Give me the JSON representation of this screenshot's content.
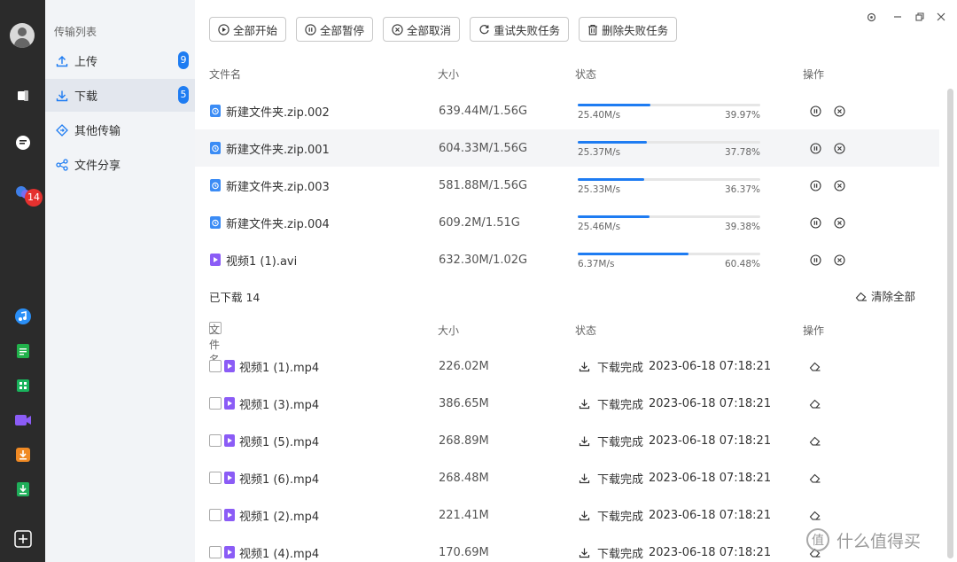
{
  "rail": {
    "notification_count": "14"
  },
  "nav": {
    "title": "传输列表",
    "items": [
      {
        "label": "上传",
        "count": "9",
        "icon": "upload-icon"
      },
      {
        "label": "下载",
        "count": "5",
        "icon": "download-icon",
        "active": true
      },
      {
        "label": "其他传输",
        "icon": "transfer-icon"
      },
      {
        "label": "文件分享",
        "icon": "share-icon"
      }
    ]
  },
  "toolbar": {
    "start_all": "全部开始",
    "pause_all": "全部暂停",
    "cancel_all": "全部取消",
    "retry_failed": "重试失败任务",
    "delete_failed": "删除失败任务"
  },
  "columns": {
    "name": "文件名",
    "size": "大小",
    "status": "状态",
    "actions": "操作"
  },
  "active_downloads": [
    {
      "name": "新建文件夹.zip.002",
      "size": "639.44M/1.56G",
      "speed": "25.40M/s",
      "percent": "39.97%",
      "progress": 0.3997,
      "type": "zip"
    },
    {
      "name": "新建文件夹.zip.001",
      "size": "604.33M/1.56G",
      "speed": "25.37M/s",
      "percent": "37.78%",
      "progress": 0.3778,
      "type": "zip"
    },
    {
      "name": "新建文件夹.zip.003",
      "size": "581.88M/1.56G",
      "speed": "25.33M/s",
      "percent": "36.37%",
      "progress": 0.3637,
      "type": "zip"
    },
    {
      "name": "新建文件夹.zip.004",
      "size": "609.2M/1.51G",
      "speed": "25.46M/s",
      "percent": "39.38%",
      "progress": 0.3938,
      "type": "zip"
    },
    {
      "name": "视频1 (1).avi",
      "size": "632.30M/1.02G",
      "speed": "6.37M/s",
      "percent": "60.48%",
      "progress": 0.6048,
      "type": "video"
    }
  ],
  "completed_section": {
    "title": "已下载 14",
    "clear_all": "清除全部"
  },
  "completed": [
    {
      "name": "视频1 (1).mp4",
      "size": "226.02M",
      "status": "下载完成",
      "time": "2023-06-18 07:18:21"
    },
    {
      "name": "视频1 (3).mp4",
      "size": "386.65M",
      "status": "下载完成",
      "time": "2023-06-18 07:18:21"
    },
    {
      "name": "视频1 (5).mp4",
      "size": "268.89M",
      "status": "下载完成",
      "time": "2023-06-18 07:18:21"
    },
    {
      "name": "视频1 (6).mp4",
      "size": "268.48M",
      "status": "下载完成",
      "time": "2023-06-18 07:18:21"
    },
    {
      "name": "视频1 (2).mp4",
      "size": "221.41M",
      "status": "下载完成",
      "time": "2023-06-18 07:18:21"
    },
    {
      "name": "视频1 (4).mp4",
      "size": "170.69M",
      "status": "下载完成",
      "time": "2023-06-18 07:18:21"
    }
  ],
  "watermark": "什么值得买",
  "colors": {
    "accent": "#1e7cf2",
    "rail": "#2b2b2b",
    "nav_bg": "#f2f4f7",
    "badge_red": "#e5312f",
    "video_purple": "#8b5cf6"
  }
}
